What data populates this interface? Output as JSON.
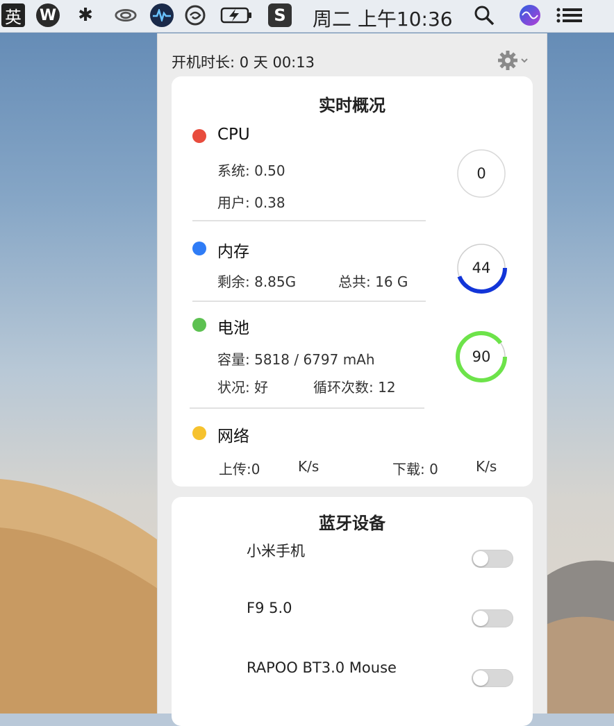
{
  "menubar": {
    "input_method": "英",
    "clock": "周二 上午10:36"
  },
  "panel": {
    "uptime": "开机时长: 0 天 00:13"
  },
  "overview": {
    "title": "实时概况",
    "cpu": {
      "label": "CPU",
      "system": "系统: 0.50",
      "user": "用户: 0.38",
      "gauge_value": "0",
      "gauge_percent": 0,
      "color": "#e84c3d"
    },
    "memory": {
      "label": "内存",
      "free": "剩余: 8.85G",
      "total": "总共: 16 G",
      "gauge_value": "44",
      "gauge_percent": 44,
      "color": "#2f7cf6",
      "arc_color": "#1235d8"
    },
    "battery": {
      "label": "电池",
      "capacity": "容量:  5818 / 6797 mAh",
      "status": "状况:  好",
      "cycles": "循环次数: 12",
      "gauge_value": "90",
      "gauge_percent": 90,
      "color": "#5dc151",
      "arc_color": "#6de34a"
    },
    "network": {
      "label": "网络",
      "upload": "上传:0",
      "upload_unit": "K/s",
      "download": "下载: 0",
      "download_unit": "K/s",
      "color": "#f6c22e"
    }
  },
  "bluetooth": {
    "title": "蓝牙设备",
    "devices": [
      {
        "name": "小米手机",
        "enabled": false
      },
      {
        "name": "F9 5.0",
        "enabled": false
      },
      {
        "name": "RAPOO BT3.0 Mouse",
        "enabled": false
      }
    ]
  }
}
